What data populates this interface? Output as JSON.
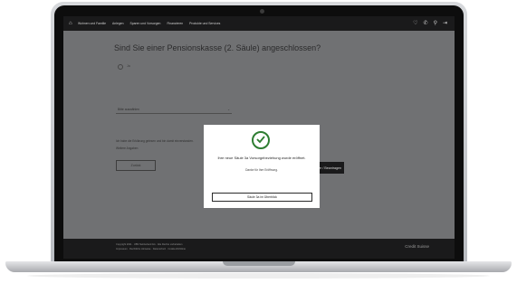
{
  "nav": {
    "items": [
      "Wohnen und Familie",
      "Anlegen",
      "Sparen und Vorsorgen",
      "Finanzieren",
      "Produkte und Services"
    ]
  },
  "page": {
    "question": "Sind Sie einer Pensionskasse (2. Säule) angeschlossen?",
    "radio_label": "Ja",
    "select_placeholder": "Bitte auswählen",
    "help_text": "Ich habe die Erklärung gelesen und bin damit einverstanden.",
    "more_link": "Weitere Angaben",
    "back_button": "Zurück",
    "continue_button": "Weiter / Beantragen"
  },
  "modal": {
    "title": "Ihre neue Säule 3a Vorsorgebeziehung wurde eröffnet.",
    "subtitle": "Danke für Ihre Eröffnung.",
    "button": "Säule 3a im Überblick"
  },
  "footer": {
    "line1": "Copyright 2021 · UBS Switzerland AG · Alle Rechte vorbehalten",
    "line2": "Impressum · Rechtliche Hinweise · Datenschutz · Cookie-Richtlinie",
    "brand": "Credit Suisse"
  },
  "colors": {
    "accent_green": "#2e7d32",
    "topbar": "#1a1a1b",
    "overlay": "#6e6f71"
  }
}
